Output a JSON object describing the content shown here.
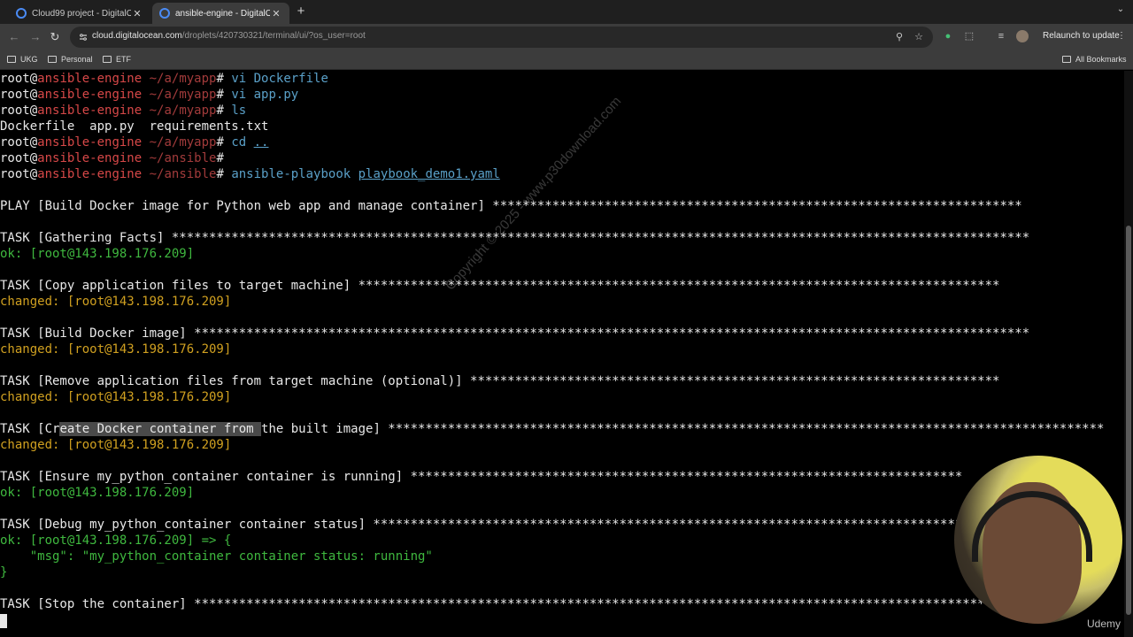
{
  "browser": {
    "tabs": [
      {
        "title": "Cloud99 project - DigitalOcean",
        "active": false
      },
      {
        "title": "ansible-engine - DigitalOcean",
        "active": true
      }
    ],
    "url_host": "cloud.digitalocean.com",
    "url_path": "/droplets/420730321/terminal/ui/?os_user=root",
    "relaunch_label": "Relaunch to update",
    "bookmarks": [
      "UKG",
      "Personal",
      "ETF"
    ],
    "all_bookmarks_label": "All Bookmarks"
  },
  "terminal": {
    "prompt_user": "root",
    "prompt_host": "ansible-engine",
    "lines": {
      "l1_path": "~/a/myapp",
      "l1_cmd": "vi Dockerfile",
      "l2_path": "~/a/myapp",
      "l2_cmd": "vi app.py",
      "l3_path": "~/a/myapp",
      "l3_cmd": "ls",
      "l4_output": "Dockerfile  app.py  requirements.txt",
      "l5_path": "~/a/myapp",
      "l5_cmd": "cd",
      "l5_arg": "..",
      "l6_path": "~/ansible",
      "l7_path": "~/ansible",
      "l7_cmd": "ansible-playbook",
      "l7_arg": "playbook_demo1.yaml",
      "play": "PLAY [Build Docker image for Python web app and manage container] ***********************************************************************",
      "task_gather": "TASK [Gathering Facts] *******************************************************************************************************************",
      "ok_gather": "ok: [root@143.198.176.209]",
      "task_copy": "TASK [Copy application files to target machine] **************************************************************************************",
      "changed_copy": "changed: [root@143.198.176.209]",
      "task_build": "TASK [Build Docker image] ****************************************************************************************************************",
      "changed_build": "changed: [root@143.198.176.209]",
      "task_remove": "TASK [Remove application files from target machine (optional)] ***********************************************************************",
      "changed_remove": "changed: [root@143.198.176.209]",
      "task_create_a": "TASK [Cr",
      "task_create_sel": "eate Docker container from ",
      "task_create_b": "the built image] ************************************************************************************************",
      "changed_create": "changed: [root@143.198.176.209]",
      "task_ensure": "TASK [Ensure my_python_container container is running] **************************************************************************",
      "ok_ensure": "ok: [root@143.198.176.209]",
      "task_debug": "TASK [Debug my_python_container container status] ********************************************************************************",
      "ok_debug": "ok: [root@143.198.176.209] => {",
      "msg_line": "    \"msg\": \"my_python_container container status: running\"",
      "close_brace": "}",
      "task_stop": "TASK [Stop the container] ************************************************************************************************************"
    }
  },
  "watermark": "Copyright © 2025 - www.p30download.com",
  "udemy_label": "Udemy",
  "colors": {
    "prompt_host": "#d74848",
    "prompt_path": "#a23b3b",
    "command": "#5aa0c8",
    "ok": "#3fb83f",
    "changed": "#d0a020"
  }
}
